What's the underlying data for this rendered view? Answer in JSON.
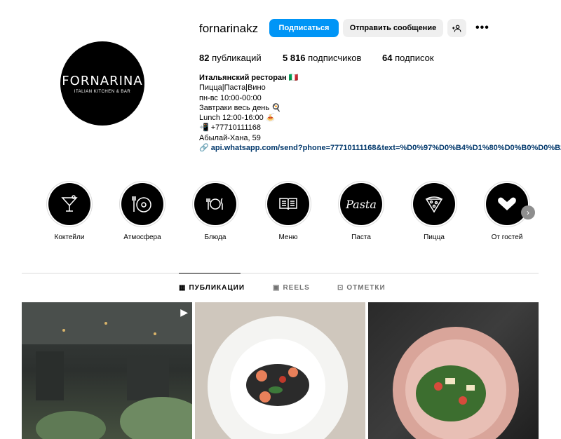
{
  "profile": {
    "username": "fornarinakz",
    "avatar_brand": "FORNARINA",
    "avatar_sub": "ITALIAN KITCHEN & BAR",
    "follow_label": "Подписаться",
    "message_label": "Отправить сообщение",
    "more_label": "•••"
  },
  "stats": {
    "posts_num": "82",
    "posts_label": "публикаций",
    "followers_num": "5 816",
    "followers_label": "подписчиков",
    "following_num": "64",
    "following_label": "подписок"
  },
  "bio": {
    "name": "Итальянский ресторан 🇮🇹",
    "lines": [
      "Пицца|Паста|Вино",
      "пн-вс 10:00-00:00",
      "Завтраки весь день 🍳",
      "Lunch 12:00-16:00 🍝",
      "📲 +77710111168",
      "Абылай-Хана, 59"
    ],
    "link": "api.whatsapp.com/send?phone=77710111168&text=%D0%97%D0%B4%D1%80%D0%B0%D0%B2%D1"
  },
  "highlights": [
    {
      "label": "Коктейли",
      "icon": "cocktail-icon"
    },
    {
      "label": "Атмосфера",
      "icon": "vinyl-icon"
    },
    {
      "label": "Блюда",
      "icon": "plate-icon"
    },
    {
      "label": "Меню",
      "icon": "book-icon"
    },
    {
      "label": "Паста",
      "icon": "pasta-text-icon"
    },
    {
      "label": "Пицца",
      "icon": "pizza-icon"
    },
    {
      "label": "От гостей",
      "icon": "heart-hands-icon"
    }
  ],
  "highlight_pasta_text": "Pasta",
  "tabs": {
    "posts": "ПУБЛИКАЦИИ",
    "reels": "REELS",
    "tagged": "ОТМЕТКИ"
  },
  "colors": {
    "accent": "#0095f6",
    "link": "#00376b"
  }
}
